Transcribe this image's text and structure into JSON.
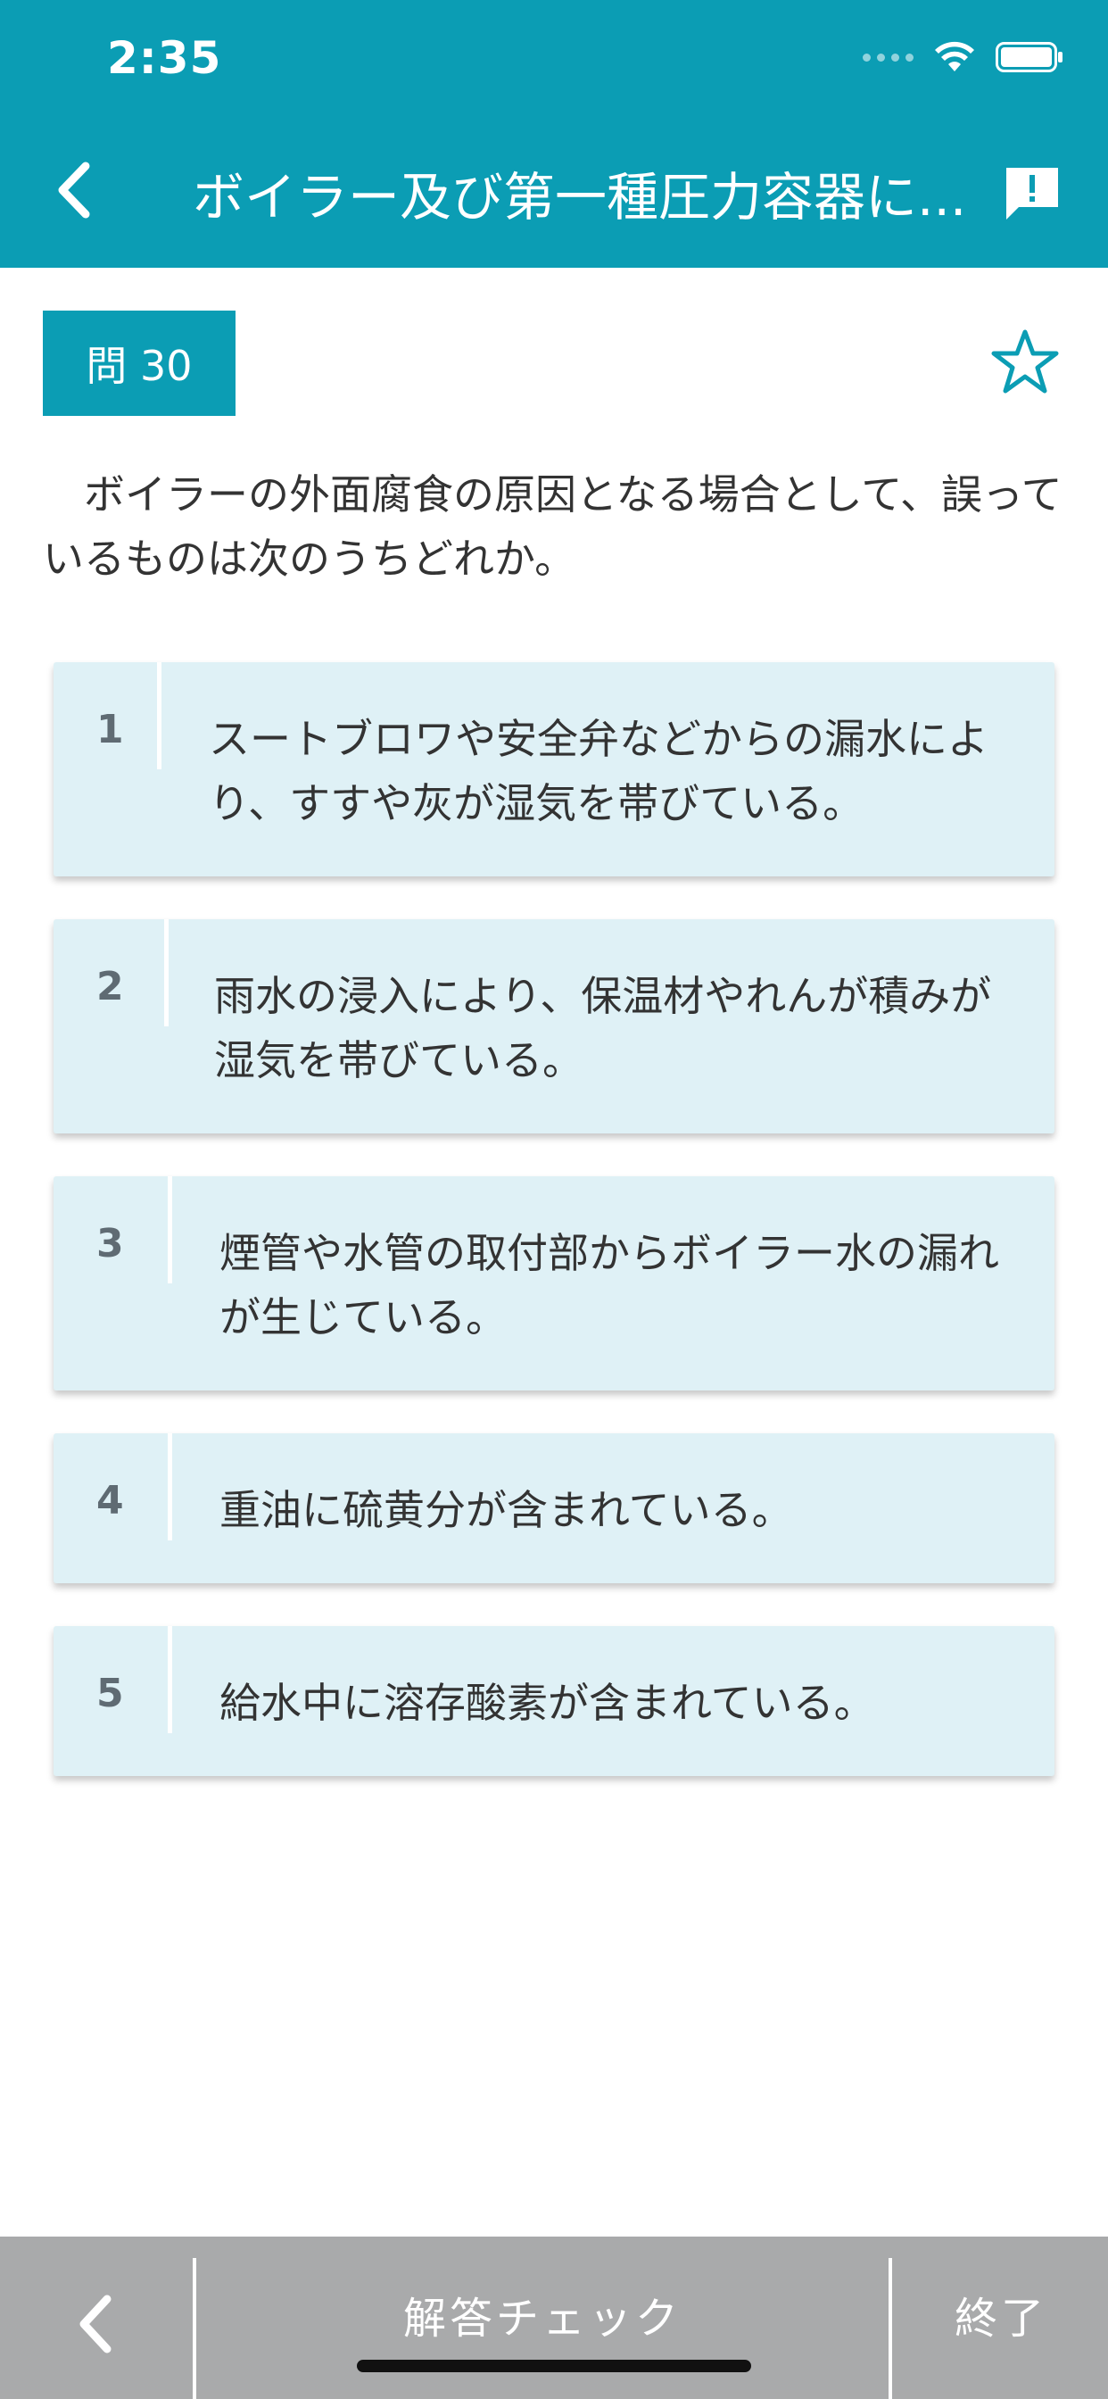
{
  "status_bar": {
    "time": "2:35"
  },
  "nav": {
    "title": "ボイラー及び第一種圧力容器に..."
  },
  "question": {
    "number_label": "問 30",
    "text": "　ボイラーの外面腐食の原因となる場合として、誤っているものは次のうちどれか。"
  },
  "choices": [
    {
      "number": "1",
      "text": "スートブロワや安全弁などからの漏水により、すすや灰が湿気を帯びている。"
    },
    {
      "number": "2",
      "text": "雨水の浸入により、保温材やれんが積みが湿気を帯びている。"
    },
    {
      "number": "3",
      "text": "煙管や水管の取付部からボイラー水の漏れが生じている。"
    },
    {
      "number": "4",
      "text": "重油に硫黄分が含まれている。"
    },
    {
      "number": "5",
      "text": "給水中に溶存酸素が含まれている。"
    }
  ],
  "bottom_bar": {
    "check_label": "解答チェック",
    "end_label": "終了"
  },
  "colors": {
    "accent": "#0b9db4",
    "choice_bg": "#dff1f6",
    "bottom_bar": "#a9aaab"
  },
  "icons": [
    "chevron-left-icon",
    "report-icon",
    "star-outline-icon",
    "wifi-icon",
    "battery-icon"
  ]
}
